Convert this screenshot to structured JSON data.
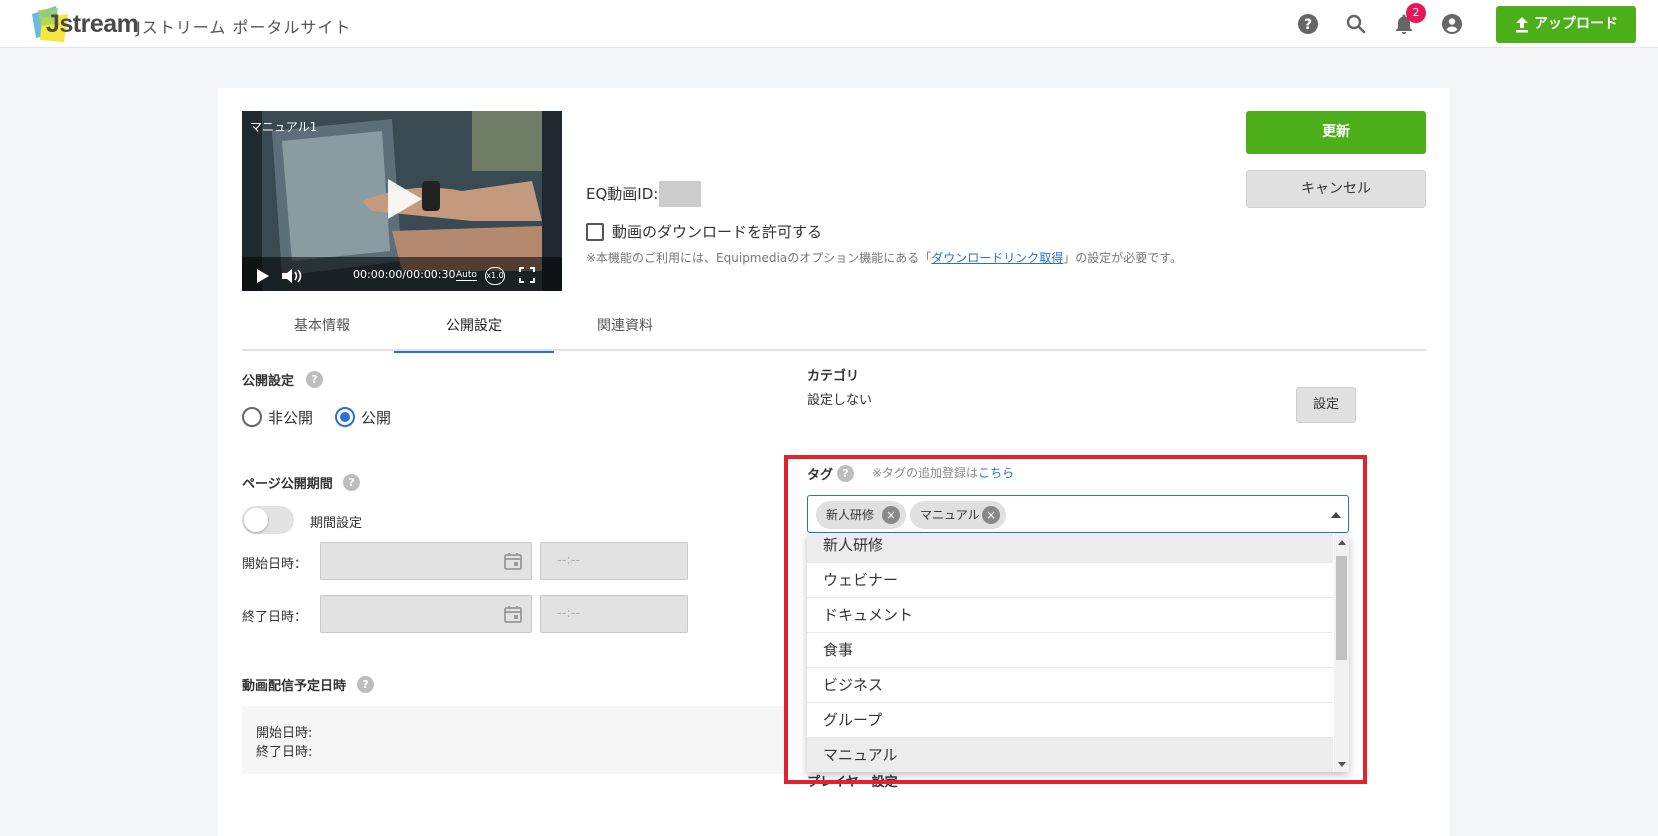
{
  "header": {
    "logo_text": "Jstream",
    "site_name": "Jストリーム ポータルサイト",
    "notification_count": "2",
    "upload_label": "アップロード",
    "icons": [
      "help-icon",
      "search-icon",
      "bell-icon",
      "account-icon",
      "upload-icon"
    ]
  },
  "video": {
    "title": "マニュアル1",
    "time": "00:00:00/00:00:30",
    "quality": "Auto",
    "speed": "x1.0"
  },
  "meta": {
    "eq_id_label": "EQ動画ID:",
    "download_label": "動画のダウンロードを許可する",
    "download_checked": false,
    "note_prefix": "※本機能のご利用には、Equipmediaのオプション機能にある「",
    "note_link": "ダウンロードリンク取得",
    "note_suffix": "」の設定が必要です。"
  },
  "actions": {
    "update_label": "更新",
    "cancel_label": "キャンセル"
  },
  "tabs": [
    {
      "label": "基本情報",
      "active": false
    },
    {
      "label": "公開設定",
      "active": true
    },
    {
      "label": "関連資料",
      "active": false
    }
  ],
  "publish": {
    "label": "公開設定",
    "options": [
      "非公開",
      "公開"
    ],
    "selected": "公開"
  },
  "period": {
    "label": "ページ公開期間",
    "toggle_label": "期間設定",
    "toggle_on": false,
    "start_label": "開始日時：",
    "end_label": "終了日時：",
    "time_placeholder": "--:--"
  },
  "schedule": {
    "label": "動画配信予定日時",
    "start_label": "開始日時:",
    "end_label": "終了日時:"
  },
  "category": {
    "label": "カテゴリ",
    "value": "設定しない",
    "button_label": "設定"
  },
  "tags": {
    "label": "タグ",
    "note_prefix": "※タグの追加登録は",
    "note_link": "こちら",
    "selected": [
      "新人研修",
      "マニュアル"
    ],
    "options": [
      "新人研修",
      "ウェビナー",
      "ドキュメント",
      "食事",
      "ビジネス",
      "グループ",
      "マニュアル"
    ],
    "highlight_color": "#e3222d"
  },
  "player": {
    "label": "プレイヤー設定"
  },
  "colors": {
    "accent_green": "#4caf1a",
    "tab_active": "#2a6fd6",
    "badge": "#e8155b"
  }
}
